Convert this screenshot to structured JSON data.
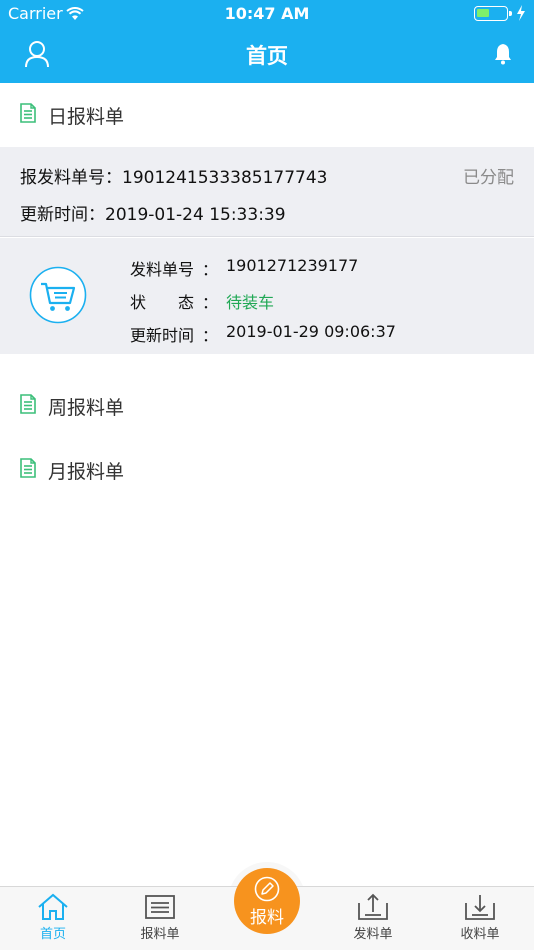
{
  "status_bar": {
    "carrier": "Carrier",
    "time": "10:47 AM"
  },
  "navbar": {
    "title": "首页"
  },
  "sections": {
    "daily": "日报料单",
    "weekly": "周报料单",
    "monthly": "月报料单"
  },
  "order": {
    "number_label": "报发料单号：",
    "number_value": "1901241533385177743",
    "status": "已分配",
    "updated_label": "更新时间：",
    "updated_value": "2019-01-24 15:33:39"
  },
  "shipment": {
    "number_label": "发料单号",
    "number_value": "1901271239177",
    "state_label": "状　　态",
    "state_value": "待装车",
    "updated_label": "更新时间",
    "updated_value": "2019-01-29 09:06:37",
    "separator": "："
  },
  "tabs": [
    {
      "label": "首页"
    },
    {
      "label": "报料单"
    },
    {
      "label": "报料"
    },
    {
      "label": "发料单"
    },
    {
      "label": "收料单"
    }
  ],
  "colors": {
    "brand": "#1bb0f0",
    "accent": "#f7931e",
    "state_green": "#21a855"
  }
}
